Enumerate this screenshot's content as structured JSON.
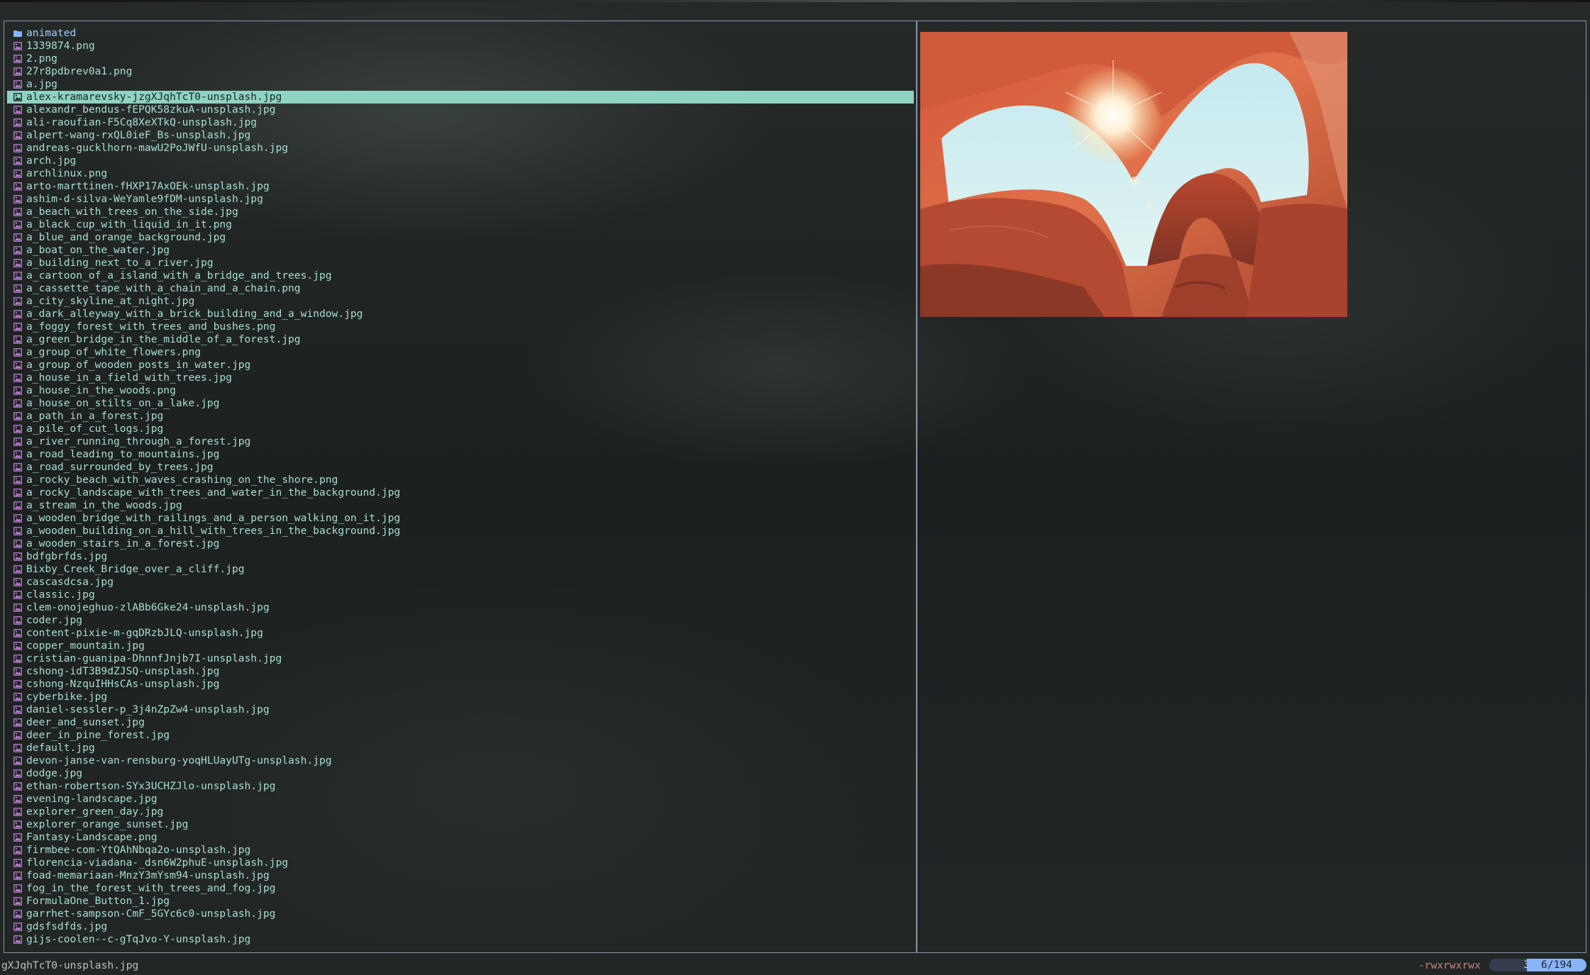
{
  "files": [
    {
      "name": "animated",
      "type": "dir"
    },
    {
      "name": "1339874.png",
      "type": "image"
    },
    {
      "name": "2.png",
      "type": "image"
    },
    {
      "name": "27r8pdbrev0a1.png",
      "type": "image"
    },
    {
      "name": "a.jpg",
      "type": "image"
    },
    {
      "name": "alex-kramarevsky-jzgXJqhTcT0-unsplash.jpg",
      "type": "image",
      "selected": true
    },
    {
      "name": "alexandr_bendus-fEPQK58zkuA-unsplash.jpg",
      "type": "image"
    },
    {
      "name": "ali-raoufian-F5Cq8XeXTkQ-unsplash.jpg",
      "type": "image"
    },
    {
      "name": "alpert-wang-rxQL0ieF_Bs-unsplash.jpg",
      "type": "image"
    },
    {
      "name": "andreas-gucklhorn-mawU2PoJWfU-unsplash.jpg",
      "type": "image"
    },
    {
      "name": "arch.jpg",
      "type": "image"
    },
    {
      "name": "archlinux.png",
      "type": "image"
    },
    {
      "name": "arto-marttinen-fHXP17AxOEk-unsplash.jpg",
      "type": "image"
    },
    {
      "name": "ashim-d-silva-WeYamle9fDM-unsplash.jpg",
      "type": "image"
    },
    {
      "name": "a_beach_with_trees_on_the_side.jpg",
      "type": "image"
    },
    {
      "name": "a_black_cup_with_liquid_in_it.png",
      "type": "image"
    },
    {
      "name": "a_blue_and_orange_background.jpg",
      "type": "image"
    },
    {
      "name": "a_boat_on_the_water.jpg",
      "type": "image"
    },
    {
      "name": "a_building_next_to_a_river.jpg",
      "type": "image"
    },
    {
      "name": "a_cartoon_of_a_island_with_a_bridge_and_trees.jpg",
      "type": "image"
    },
    {
      "name": "a_cassette_tape_with_a_chain_and_a_chain.png",
      "type": "image"
    },
    {
      "name": "a_city_skyline_at_night.jpg",
      "type": "image"
    },
    {
      "name": "a_dark_alleyway_with_a_brick_building_and_a_window.jpg",
      "type": "image"
    },
    {
      "name": "a_foggy_forest_with_trees_and_bushes.png",
      "type": "image"
    },
    {
      "name": "a_green_bridge_in_the_middle_of_a_forest.jpg",
      "type": "image"
    },
    {
      "name": "a_group_of_white_flowers.png",
      "type": "image"
    },
    {
      "name": "a_group_of_wooden_posts_in_water.jpg",
      "type": "image"
    },
    {
      "name": "a_house_in_a_field_with_trees.jpg",
      "type": "image"
    },
    {
      "name": "a_house_in_the_woods.png",
      "type": "image"
    },
    {
      "name": "a_house_on_stilts_on_a_lake.jpg",
      "type": "image"
    },
    {
      "name": "a_path_in_a_forest.jpg",
      "type": "image"
    },
    {
      "name": "a_pile_of_cut_logs.jpg",
      "type": "image"
    },
    {
      "name": "a_river_running_through_a_forest.jpg",
      "type": "image"
    },
    {
      "name": "a_road_leading_to_mountains.jpg",
      "type": "image"
    },
    {
      "name": "a_road_surrounded_by_trees.jpg",
      "type": "image"
    },
    {
      "name": "a_rocky_beach_with_waves_crashing_on_the_shore.png",
      "type": "image"
    },
    {
      "name": "a_rocky_landscape_with_trees_and_water_in_the_background.jpg",
      "type": "image"
    },
    {
      "name": "a_stream_in_the_woods.jpg",
      "type": "image"
    },
    {
      "name": "a_wooden_bridge_with_railings_and_a_person_walking_on_it.jpg",
      "type": "image"
    },
    {
      "name": "a_wooden_building_on_a_hill_with_trees_in_the_background.jpg",
      "type": "image"
    },
    {
      "name": "a_wooden_stairs_in_a_forest.jpg",
      "type": "image"
    },
    {
      "name": "bdfgbrfds.jpg",
      "type": "image"
    },
    {
      "name": "Bixby_Creek_Bridge_over_a_cliff.jpg",
      "type": "image"
    },
    {
      "name": "cascasdcsa.jpg",
      "type": "image"
    },
    {
      "name": "classic.jpg",
      "type": "image"
    },
    {
      "name": "clem-onojeghuo-zlABb6Gke24-unsplash.jpg",
      "type": "image"
    },
    {
      "name": "coder.jpg",
      "type": "image"
    },
    {
      "name": "content-pixie-m-gqDRzbJLQ-unsplash.jpg",
      "type": "image"
    },
    {
      "name": "copper_mountain.jpg",
      "type": "image"
    },
    {
      "name": "cristian-guanipa-DhnnfJnjb7I-unsplash.jpg",
      "type": "image"
    },
    {
      "name": "cshong-idT3B9dZJSQ-unsplash.jpg",
      "type": "image"
    },
    {
      "name": "cshong-NzquIHHsCAs-unsplash.jpg",
      "type": "image"
    },
    {
      "name": "cyberbike.jpg",
      "type": "image"
    },
    {
      "name": "daniel-sessler-p_3j4nZpZw4-unsplash.jpg",
      "type": "image"
    },
    {
      "name": "deer_and_sunset.jpg",
      "type": "image"
    },
    {
      "name": "deer_in_pine_forest.jpg",
      "type": "image"
    },
    {
      "name": "default.jpg",
      "type": "image"
    },
    {
      "name": "devon-janse-van-rensburg-yoqHLUayUTg-unsplash.jpg",
      "type": "image"
    },
    {
      "name": "dodge.jpg",
      "type": "image"
    },
    {
      "name": "ethan-robertson-SYx3UCHZJlo-unsplash.jpg",
      "type": "image"
    },
    {
      "name": "evening-landscape.jpg",
      "type": "image"
    },
    {
      "name": "explorer_green_day.jpg",
      "type": "image"
    },
    {
      "name": "explorer_orange_sunset.jpg",
      "type": "image"
    },
    {
      "name": "Fantasy-Landscape.png",
      "type": "image"
    },
    {
      "name": "firmbee-com-YtQAhNbqa2o-unsplash.jpg",
      "type": "image"
    },
    {
      "name": "florencia-viadana-_dsn6W2phuE-unsplash.jpg",
      "type": "image"
    },
    {
      "name": "foad-memariaan-MnzY3mYsm94-unsplash.jpg",
      "type": "image"
    },
    {
      "name": "fog_in_the_forest_with_trees_and_fog.jpg",
      "type": "image"
    },
    {
      "name": "FormulaOne_Button_1.jpg",
      "type": "image"
    },
    {
      "name": "garrhet-sampson-CmF_5GYc6c0-unsplash.jpg",
      "type": "image"
    },
    {
      "name": "gdsfsdfds.jpg",
      "type": "image"
    },
    {
      "name": "gijs-coolen--c-gTqJvo-Y-unsplash.jpg",
      "type": "image"
    }
  ],
  "statusbar": {
    "current_file": "gXJqhTcT0-unsplash.jpg",
    "permissions": "-rwxrwxrwx",
    "scroll_percent": "3%",
    "position": "6/194"
  },
  "colors": {
    "file_text": "#a8ddd5",
    "dir_text": "#9fcdfa",
    "selection_bg": "#8fd3c4",
    "image_icon": "#b77bd0",
    "folder_icon": "#8ab4f8",
    "frame_border": "#8a95a8",
    "permissions": "#c98086",
    "position_pill": "#8ab4f8"
  },
  "icons": {
    "dir": "folder-icon",
    "image": "image-file-icon"
  }
}
